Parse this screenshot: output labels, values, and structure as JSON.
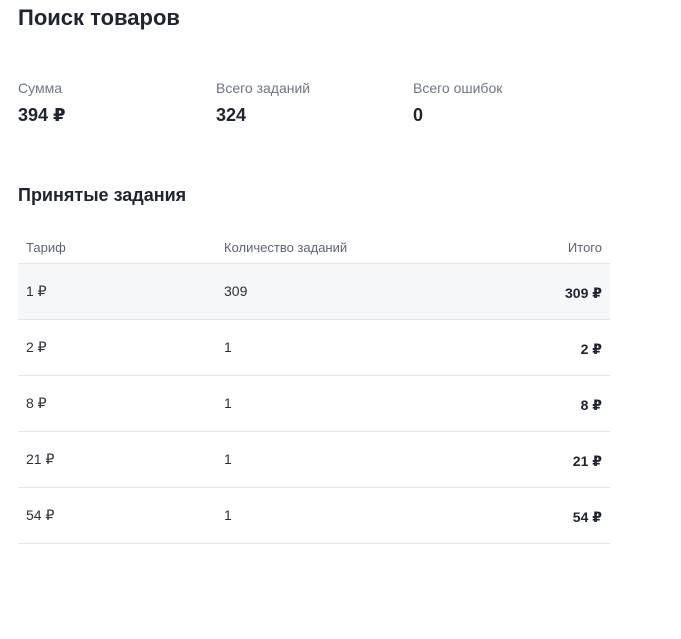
{
  "header": {
    "title": "Поиск товаров"
  },
  "stats": [
    {
      "label": "Сумма",
      "value": "394 ₽"
    },
    {
      "label": "Всего заданий",
      "value": "324"
    },
    {
      "label": "Всего ошибок",
      "value": "0"
    }
  ],
  "accepted": {
    "title": "Принятые задания",
    "columns": [
      "Тариф",
      "Количество заданий",
      "Итого"
    ],
    "rows": [
      {
        "tariff": "1 ₽",
        "count": "309",
        "total": "309 ₽"
      },
      {
        "tariff": "2 ₽",
        "count": "1",
        "total": "2 ₽"
      },
      {
        "tariff": "8 ₽",
        "count": "1",
        "total": "8 ₽"
      },
      {
        "tariff": "21 ₽",
        "count": "1",
        "total": "21 ₽"
      },
      {
        "tariff": "54 ₽",
        "count": "1",
        "total": "54 ₽"
      }
    ]
  }
}
